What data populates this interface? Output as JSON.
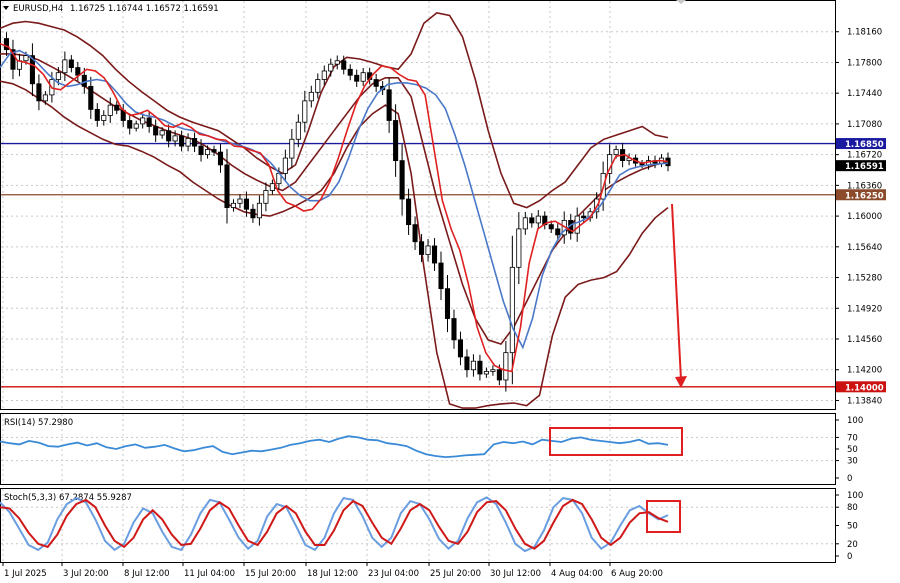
{
  "header": {
    "symbol": "EURUSD,H4",
    "ohlc": "1.16725 1.16744 1.16572 1.16591"
  },
  "colors": {
    "candle": "#000000",
    "grid": "#c8c8c8",
    "bollinger": "#7a1a1a",
    "ma_fast": "#e02020",
    "ma_slow": "#4a78c8",
    "hline_blue": "#1a1aa0",
    "hline_brown": "#8b4a2a",
    "hline_red": "#cc1111",
    "annotation": "#e02020",
    "rsi_line": "#3a8ad8",
    "stoch_main": "#6a9ee0",
    "stoch_signal": "#d01818"
  },
  "chart_data": [
    {
      "type": "candlestick",
      "title": "EURUSD,H4",
      "y_ticks": [
        "1.18160",
        "1.17800",
        "1.17440",
        "1.17080",
        "1.16720",
        "1.16360",
        "1.16000",
        "1.15640",
        "1.15280",
        "1.14920",
        "1.14560",
        "1.14200",
        "1.13840"
      ],
      "ylim": [
        1.1374,
        1.1852
      ],
      "x_ticks": [
        "1 Jul 2025",
        "3 Jul 20:00",
        "8 Jul 12:00",
        "11 Jul 04:00",
        "15 Jul 20:00",
        "18 Jul 12:00",
        "23 Jul 04:00",
        "25 Jul 20:00",
        "30 Jul 12:00",
        "4 Aug 04:00",
        "6 Aug 20:00"
      ],
      "price_tags": [
        {
          "label": "1.16850",
          "value": 1.1685,
          "style": "blue"
        },
        {
          "label": "1.16591",
          "value": 1.16591,
          "style": "black"
        },
        {
          "label": "1.16250",
          "value": 1.1625,
          "style": "brown"
        },
        {
          "label": "1.14000",
          "value": 1.14,
          "style": "red"
        }
      ],
      "horizontal_lines": [
        {
          "value": 1.1685,
          "color": "blue"
        },
        {
          "value": 1.1625,
          "color": "brown"
        },
        {
          "value": 1.14,
          "color": "red"
        }
      ],
      "close_path": [
        1.1808,
        1.1795,
        1.1772,
        1.1782,
        1.1788,
        1.1755,
        1.1735,
        1.1742,
        1.176,
        1.1768,
        1.1783,
        1.1774,
        1.1765,
        1.1752,
        1.1725,
        1.1712,
        1.1718,
        1.173,
        1.1724,
        1.1712,
        1.1703,
        1.1708,
        1.1715,
        1.1705,
        1.1695,
        1.17,
        1.1688,
        1.1694,
        1.1682,
        1.1691,
        1.1682,
        1.1672,
        1.1678,
        1.1675,
        1.166,
        1.161,
        1.1615,
        1.162,
        1.1608,
        1.1598,
        1.1615,
        1.163,
        1.1638,
        1.165,
        1.1668,
        1.169,
        1.171,
        1.1735,
        1.1745,
        1.176,
        1.177,
        1.1778,
        1.1782,
        1.1772,
        1.1765,
        1.1758,
        1.1768,
        1.176,
        1.1752,
        1.1748,
        1.1712,
        1.1665,
        1.162,
        1.159,
        1.157,
        1.1555,
        1.1565,
        1.1545,
        1.1515,
        1.148,
        1.1455,
        1.1435,
        1.142,
        1.143,
        1.1415,
        1.1418,
        1.142,
        1.1408,
        1.144,
        1.154,
        1.1585,
        1.1598,
        1.1592,
        1.16,
        1.159,
        1.1585,
        1.1578,
        1.1595,
        1.158,
        1.16,
        1.1598,
        1.1605,
        1.162,
        1.165,
        1.1672,
        1.1678,
        1.1665,
        1.1668,
        1.1662,
        1.166,
        1.1665,
        1.1662,
        1.1668,
        1.1659
      ],
      "bollinger_upper_path": [
        1.182,
        1.1826,
        1.1828,
        1.1826,
        1.1822,
        1.1818,
        1.181,
        1.18,
        1.1788,
        1.1772,
        1.1758,
        1.1746,
        1.1735,
        1.1724,
        1.1716,
        1.171,
        1.1705,
        1.17,
        1.169,
        1.168,
        1.1668,
        1.1658,
        1.165,
        1.166,
        1.17,
        1.1745,
        1.1775,
        1.1786,
        1.1784,
        1.178,
        1.1775,
        1.1772,
        1.179,
        1.1826,
        1.1838,
        1.1835,
        1.181,
        1.176,
        1.17,
        1.165,
        1.1615,
        1.161,
        1.1618,
        1.163,
        1.164,
        1.166,
        1.168,
        1.169,
        1.1695,
        1.17,
        1.1705,
        1.1695,
        1.1692
      ],
      "bollinger_middle_path": [
        1.179,
        1.179,
        1.1788,
        1.1783,
        1.1775,
        1.1767,
        1.1758,
        1.1748,
        1.1738,
        1.1728,
        1.172,
        1.1712,
        1.1706,
        1.17,
        1.1695,
        1.169,
        1.1682,
        1.1672,
        1.166,
        1.165,
        1.1642,
        1.1635,
        1.163,
        1.164,
        1.166,
        1.168,
        1.17,
        1.172,
        1.174,
        1.1755,
        1.1762,
        1.1762,
        1.174,
        1.168,
        1.162,
        1.157,
        1.152,
        1.148,
        1.1455,
        1.145,
        1.147,
        1.15,
        1.153,
        1.156,
        1.158,
        1.16,
        1.1615,
        1.163,
        1.164,
        1.1648,
        1.1655,
        1.166,
        1.1664
      ],
      "bollinger_lower_path": [
        1.1758,
        1.1755,
        1.1748,
        1.1738,
        1.1728,
        1.1716,
        1.1706,
        1.1698,
        1.169,
        1.1684,
        1.1682,
        1.1676,
        1.1669,
        1.166,
        1.1652,
        1.164,
        1.163,
        1.162,
        1.1612,
        1.1605,
        1.1602,
        1.16,
        1.1605,
        1.1612,
        1.162,
        1.163,
        1.165,
        1.168,
        1.1705,
        1.172,
        1.173,
        1.172,
        1.165,
        1.154,
        1.144,
        1.138,
        1.1375,
        1.1375,
        1.1378,
        1.138,
        1.1381,
        1.1378,
        1.139,
        1.146,
        1.1505,
        1.152,
        1.1525,
        1.1528,
        1.1535,
        1.1555,
        1.158,
        1.1598,
        1.161
      ],
      "ma_fast_path": [
        1.1802,
        1.1798,
        1.1782,
        1.178,
        1.1776,
        1.1766,
        1.175,
        1.1748,
        1.1756,
        1.1764,
        1.1772,
        1.177,
        1.1762,
        1.1746,
        1.1726,
        1.1718,
        1.172,
        1.1724,
        1.1716,
        1.1706,
        1.1704,
        1.1709,
        1.1704,
        1.1696,
        1.1694,
        1.169,
        1.1689,
        1.1682,
        1.1681,
        1.1677,
        1.1674,
        1.166,
        1.163,
        1.1616,
        1.1612,
        1.1606,
        1.1608,
        1.162,
        1.164,
        1.1668,
        1.17,
        1.173,
        1.1752,
        1.1766,
        1.1776,
        1.1774,
        1.1766,
        1.176,
        1.1758,
        1.1742,
        1.168,
        1.1618,
        1.1585,
        1.156,
        1.152,
        1.147,
        1.144,
        1.1425,
        1.142,
        1.1418,
        1.147,
        1.1545,
        1.1585,
        1.1592,
        1.1594,
        1.1588,
        1.1582,
        1.159,
        1.1598,
        1.1615,
        1.165,
        1.167,
        1.1672,
        1.1666,
        1.1662,
        1.1664,
        1.1665,
        1.1664
      ],
      "ma_slow_path": [
        1.1774,
        1.179,
        1.1794,
        1.1788,
        1.1778,
        1.1766,
        1.1756,
        1.1752,
        1.1754,
        1.1758,
        1.176,
        1.1758,
        1.1746,
        1.1732,
        1.1722,
        1.1718,
        1.1716,
        1.1712,
        1.1706,
        1.1702,
        1.17,
        1.1696,
        1.1692,
        1.1688,
        1.1685,
        1.1682,
        1.1678,
        1.1672,
        1.1662,
        1.1648,
        1.1634,
        1.1624,
        1.1618,
        1.1618,
        1.1624,
        1.164,
        1.1668,
        1.17,
        1.1726,
        1.1744,
        1.1754,
        1.1756,
        1.1756,
        1.1754,
        1.175,
        1.1742,
        1.1726,
        1.1695,
        1.166,
        1.162,
        1.158,
        1.154,
        1.15,
        1.1468,
        1.1446,
        1.148,
        1.153,
        1.156,
        1.158,
        1.159,
        1.1594,
        1.16,
        1.1612,
        1.163,
        1.1648,
        1.1655,
        1.1658,
        1.166,
        1.1661,
        1.1662
      ]
    },
    {
      "type": "line",
      "title": "RSI(14) 57.2980",
      "y_ticks": [
        "100",
        "70",
        "50",
        "30",
        "0"
      ],
      "ylim": [
        0,
        100
      ],
      "series": [
        {
          "name": "RSI(14)",
          "values": [
            63,
            60,
            58,
            64,
            61,
            55,
            54,
            58,
            61,
            56,
            60,
            53,
            50,
            55,
            58,
            52,
            54,
            57,
            51,
            46,
            48,
            52,
            55,
            45,
            41,
            44,
            47,
            46,
            49,
            52,
            57,
            60,
            64,
            66,
            62,
            68,
            72,
            70,
            66,
            65,
            60,
            58,
            55,
            47,
            41,
            38,
            36,
            37,
            39,
            40,
            41,
            58,
            62,
            60,
            63,
            58,
            66,
            64,
            62,
            68,
            70,
            66,
            64,
            62,
            60,
            62,
            66,
            59,
            60,
            57
          ]
        }
      ]
    },
    {
      "type": "line",
      "title": "Stoch(5,3,3) 67.2874 55.9287",
      "y_ticks": [
        "100",
        "80",
        "50",
        "20",
        "0"
      ],
      "ylim": [
        0,
        100
      ],
      "series": [
        {
          "name": "Stoch main",
          "values": [
            88,
            72,
            45,
            18,
            10,
            22,
            60,
            85,
            95,
            88,
            60,
            25,
            10,
            20,
            55,
            78,
            70,
            40,
            15,
            10,
            35,
            70,
            92,
            88,
            60,
            30,
            12,
            25,
            65,
            85,
            80,
            50,
            18,
            10,
            30,
            70,
            95,
            92,
            65,
            30,
            15,
            30,
            70,
            90,
            85,
            60,
            28,
            12,
            25,
            62,
            88,
            96,
            85,
            55,
            20,
            8,
            15,
            42,
            80,
            95,
            92,
            70,
            30,
            12,
            22,
            50,
            75,
            82,
            70,
            60,
            67
          ]
        },
        {
          "name": "Stoch signal",
          "values": [
            80,
            78,
            62,
            38,
            20,
            15,
            35,
            66,
            85,
            92,
            80,
            50,
            25,
            15,
            30,
            60,
            75,
            60,
            35,
            18,
            20,
            45,
            75,
            88,
            78,
            50,
            25,
            18,
            40,
            70,
            82,
            70,
            40,
            18,
            18,
            42,
            75,
            90,
            82,
            55,
            30,
            20,
            45,
            75,
            85,
            75,
            48,
            25,
            20,
            40,
            72,
            88,
            90,
            75,
            45,
            20,
            12,
            25,
            55,
            82,
            92,
            85,
            60,
            30,
            18,
            30,
            55,
            70,
            72,
            62,
            56
          ]
        }
      ]
    }
  ]
}
